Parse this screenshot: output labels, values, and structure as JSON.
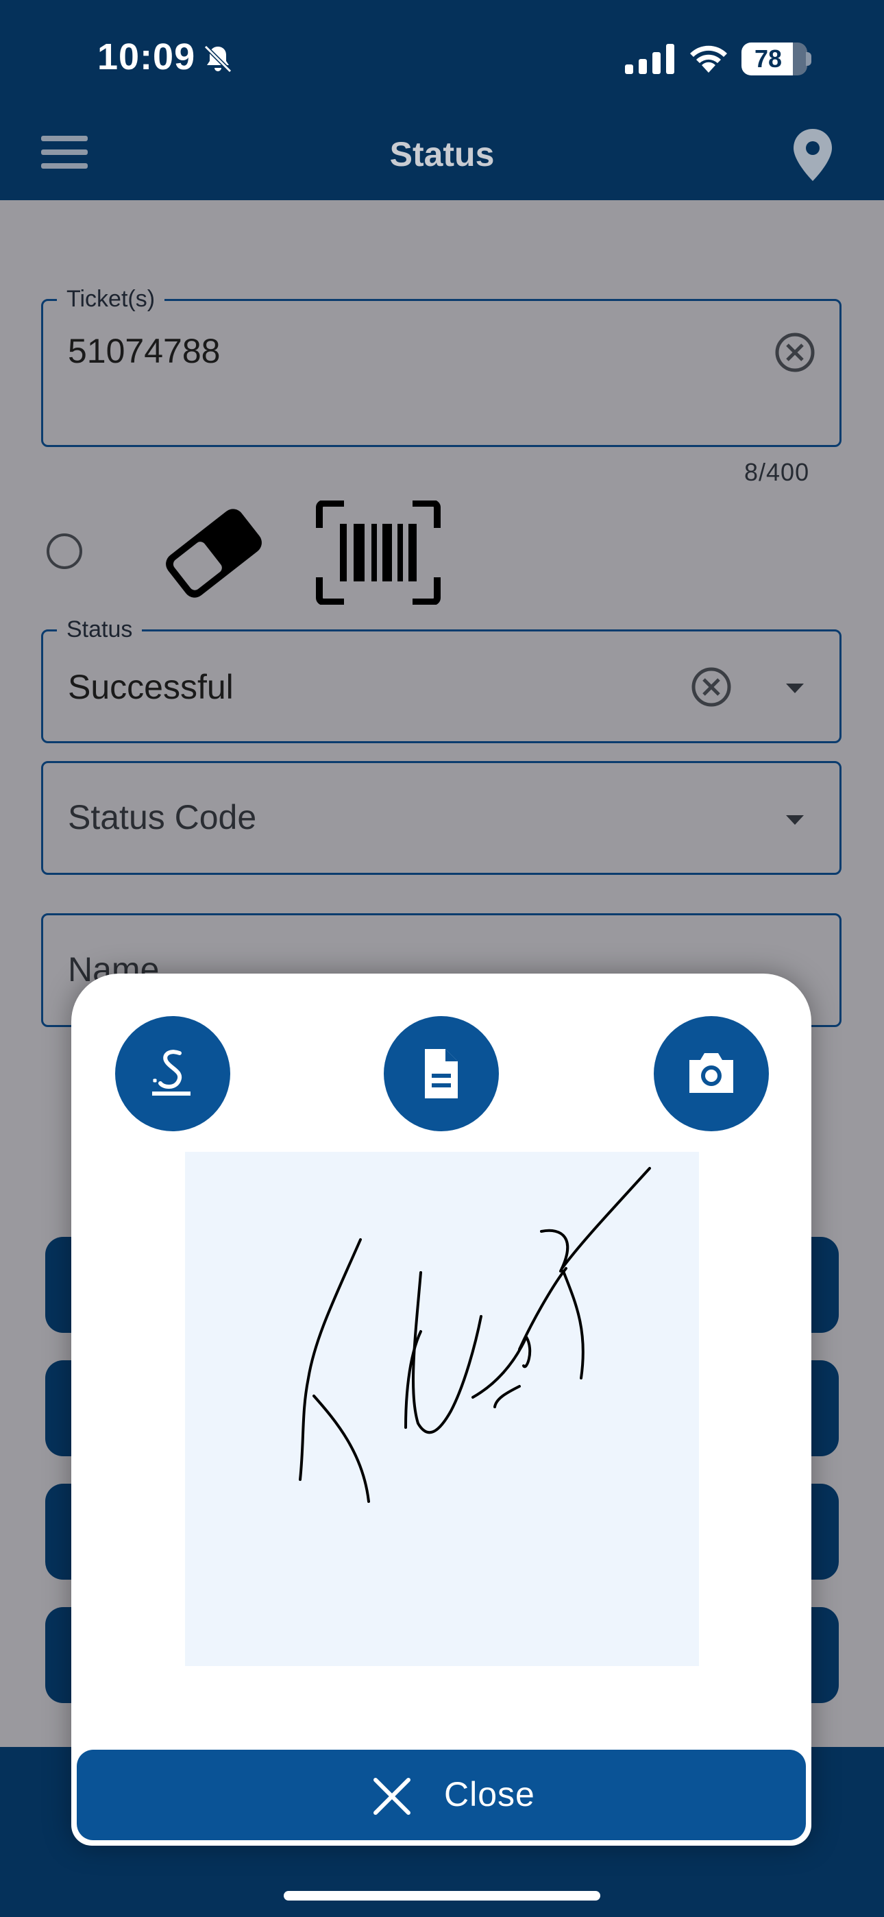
{
  "status_bar": {
    "time": "10:09",
    "battery": "78",
    "battery_fraction": 0.78,
    "icons": [
      "bell-slash-icon",
      "signal-icon",
      "wifi-icon",
      "battery-icon"
    ]
  },
  "app_bar": {
    "title": "Status",
    "left_icon": "menu-icon",
    "right_icon": "location-icon"
  },
  "form": {
    "tickets": {
      "label": "Ticket(s)",
      "value": "51074788",
      "counter": "8/400"
    },
    "status": {
      "label": "Status",
      "value": "Successful"
    },
    "status_code": {
      "placeholder": "Status Code"
    },
    "name": {
      "placeholder": "Name"
    },
    "tool_icons": [
      "radio-button",
      "eraser-icon",
      "barcode-icon"
    ]
  },
  "dialog": {
    "buttons": [
      "signature-icon",
      "document-icon",
      "camera-icon"
    ],
    "close_label": "Close"
  },
  "colors": {
    "primary_dark": "#05315a",
    "primary": "#0a5396",
    "signature_pad": "#eef5fd",
    "overlay_bg": "#9a999e"
  }
}
